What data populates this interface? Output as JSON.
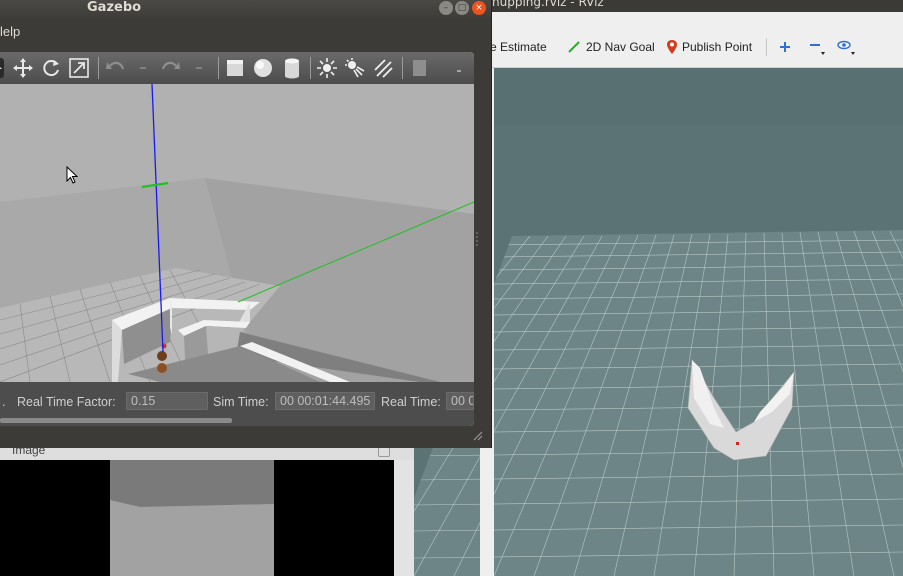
{
  "gazebo": {
    "title": "Gazebo",
    "window_buttons": [
      "minimize",
      "maximize",
      "close"
    ],
    "menu_partial": "Help",
    "menu_partial_visible": "lelp",
    "toolbar_icons": [
      "select-arrow-icon",
      "translate-icon",
      "rotate-icon",
      "scale-icon",
      "undo-icon",
      "undo-dropdown-icon",
      "redo-icon",
      "redo-dropdown-icon",
      "box-icon",
      "sphere-icon",
      "cylinder-icon",
      "point-light-icon",
      "spot-light-icon",
      "directional-light-icon",
      "copy-icon",
      "toolbar-more-icon"
    ],
    "status": {
      "real_time_factor_label": "Real Time Factor:",
      "real_time_factor_value": "0.15",
      "sim_time_label": "Sim Time:",
      "sim_time_value": "00 00:01:44.495",
      "real_time_label": "Real Time:",
      "real_time_value": "00 0"
    }
  },
  "rviz": {
    "title_partial": "hupping.rviz - RViz",
    "toolbar": {
      "pose_estimate_label": "se Estimate",
      "nav_goal_label": "2D Nav Goal",
      "publish_point_label": "Publish Point"
    },
    "colors": {
      "background": "#5b7374",
      "grid": "#a9bcbc",
      "map_free": "#dcdcdc"
    }
  },
  "image_panel": {
    "title": "Image"
  },
  "colors": {
    "gazebo_chrome": "#3c3b37",
    "x_axis": "#22c022",
    "z_axis": "#1a1af0",
    "close_button": "#e95420"
  }
}
